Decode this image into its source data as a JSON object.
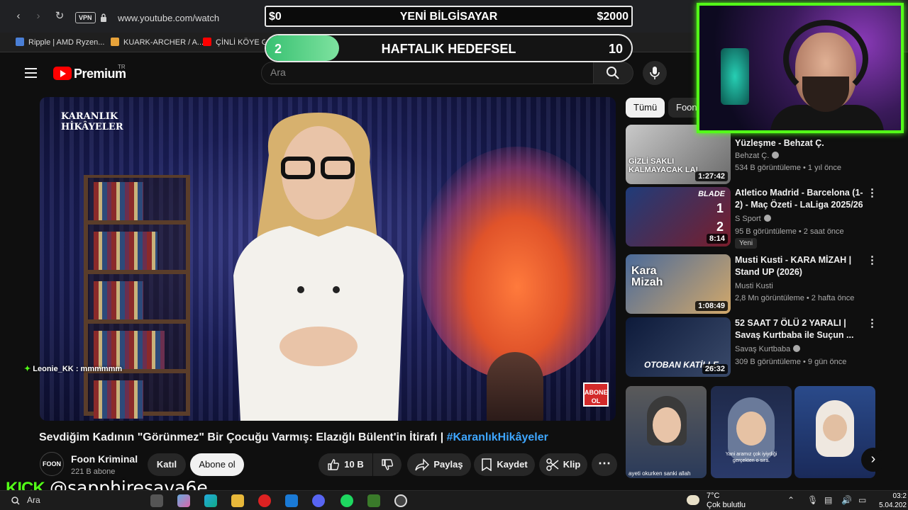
{
  "browser": {
    "vpn_label": "VPN",
    "url": "www.youtube.com/watch",
    "bookmarks": [
      {
        "label": "Ripple | AMD Ryzen...",
        "color": "#4a7fd6"
      },
      {
        "label": "KUARK-ARCHER / A...",
        "color": "#e8a33a"
      },
      {
        "label": "ÇİNLİ KÖYE GİR",
        "color": "#ff0000"
      }
    ]
  },
  "overlay": {
    "goal_start": "$0",
    "goal_title": "YENİ BİLGİSAYAR",
    "goal_end": "$2000",
    "weekly_current": "2",
    "weekly_title": "HAFTALIK HEDEFSEL",
    "weekly_target": "10",
    "weekly_progress": 0.2,
    "accent": "#53fc18"
  },
  "youtube": {
    "brand": "Premium",
    "region": "TR",
    "search_placeholder": "Ara",
    "video": {
      "channel_logo_line1": "KARANLIK",
      "channel_logo_line2": "HİKÂYELER",
      "chat_user": "Leonie_KK",
      "chat_message": ": mmmmmm",
      "abone_line1": "ABONE",
      "abone_line2": "OL",
      "title": "Sevdiğim Kadının \"Görünmez\" Bir Çocuğu Varmış: Elazığlı Bülent'in İtirafı | ",
      "hashtag": "#KaranlıkHikâyeler"
    },
    "channel": {
      "avatar_text": "FOON",
      "name": "Foon Kriminal",
      "subs": "221 B abone",
      "join_label": "Katıl",
      "subscribe_label": "Abone ol"
    },
    "actions": {
      "likes": "10 B",
      "share": "Paylaş",
      "save": "Kaydet",
      "clip": "Klip"
    },
    "chips": [
      "Tümü",
      "Foon"
    ],
    "recommendations": [
      {
        "title": "Yüzleşme - Behzat Ç.",
        "channel": "Behzat Ç.",
        "verified": true,
        "meta": "534 B görüntüleme • 1 yıl önce",
        "duration": "1:27:42",
        "thumb_text": "GİZLİ SAKLI KALMAYACAK LA!",
        "badge": ""
      },
      {
        "title": "Atletico Madrid - Barcelona (1-2) - Maç Özeti - LaLiga 2025/26",
        "channel": "S Sport",
        "verified": true,
        "meta": "95 B görüntüleme • 2 saat önce",
        "duration": "8:14",
        "thumb_text": "BLADE",
        "badge": "Yeni"
      },
      {
        "title": "Musti Kusti - KARA MİZAH | Stand UP (2026)",
        "channel": "Musti Kusti",
        "verified": false,
        "meta": "2,8 Mn görüntüleme • 2 hafta önce",
        "duration": "1:08:49",
        "thumb_text": "Kara Mizah",
        "badge": ""
      },
      {
        "title": "52 SAAT 7 ÖLÜ 2 YARALI | Savaş Kurtbaba ile Suçun ...",
        "channel": "Savaş Kurtbaba",
        "verified": true,
        "meta": "309 B görüntüleme • 9 gün önce",
        "duration": "26:32",
        "thumb_text": "OTOBAN KATİLLE",
        "badge": ""
      }
    ],
    "shorts": [
      {
        "caption": "ayeti okurken sanki allah"
      },
      {
        "caption": "Yani aramız çok iyiydiği gerçekten o sıra."
      },
      {
        "caption": ""
      }
    ]
  },
  "stream": {
    "platform": "KICK",
    "handle": "@sapphiresava6e"
  },
  "taskbar": {
    "search_label": "Ara",
    "temp": "7°C",
    "weather": "Çok bulutlu",
    "time": "03:2",
    "date": "5.04.202"
  }
}
